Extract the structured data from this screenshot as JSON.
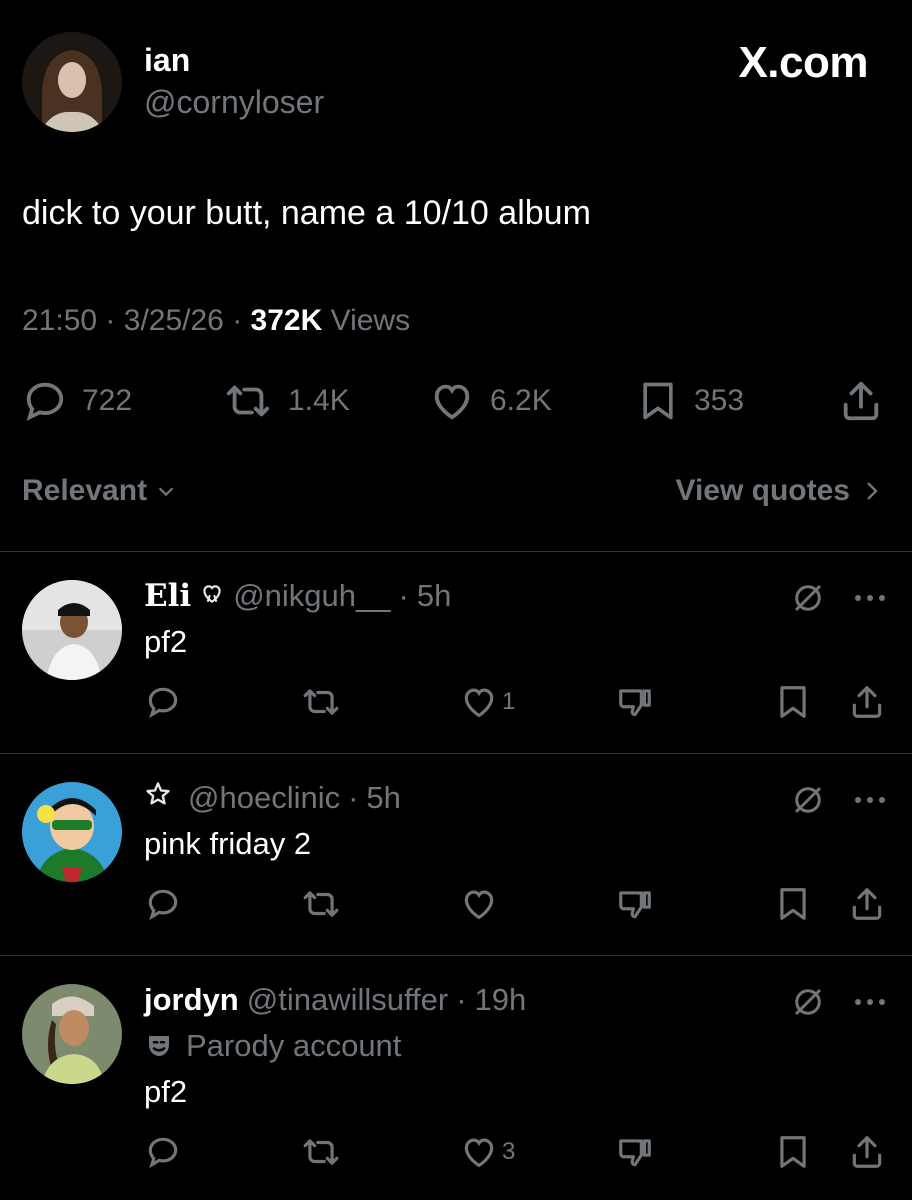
{
  "post": {
    "author_name": "ian",
    "author_handle": "@cornyloser",
    "site_label": "X.com",
    "text": "dick to your butt, name a 10/10 album",
    "time": "21:50",
    "date": "3/25/26",
    "views_count": "372K",
    "views_label": "Views",
    "replies": "722",
    "reposts": "1.4K",
    "likes": "6.2K",
    "bookmarks": "353"
  },
  "sort": {
    "label": "Relevant",
    "quotes_label": "View quotes"
  },
  "replies": [
    {
      "name": "Eli",
      "handle": "@nikguh__",
      "age": "5h",
      "text": "pf2",
      "likes": "1"
    },
    {
      "name": "",
      "handle": "@hoeclinic",
      "age": "5h",
      "text": "pink friday 2",
      "likes": ""
    },
    {
      "name": "jordyn",
      "handle": "@tinawillsuffer",
      "age": "19h",
      "parody": "Parody account",
      "text": "pf2",
      "likes": "3"
    }
  ],
  "meta_sep": "·",
  "icons": [
    "reply-icon",
    "repost-icon",
    "like-icon",
    "bookmark-icon",
    "share-icon",
    "grok-icon",
    "more-icon",
    "dislike-icon",
    "chevron-down-icon",
    "chevron-right-icon",
    "star-icon",
    "heart-ribbon-icon",
    "parody-mask-icon"
  ],
  "colors": {
    "background": "#000000",
    "text": "#e7e9ea",
    "muted": "#71767b",
    "divider": "#2f3336"
  }
}
